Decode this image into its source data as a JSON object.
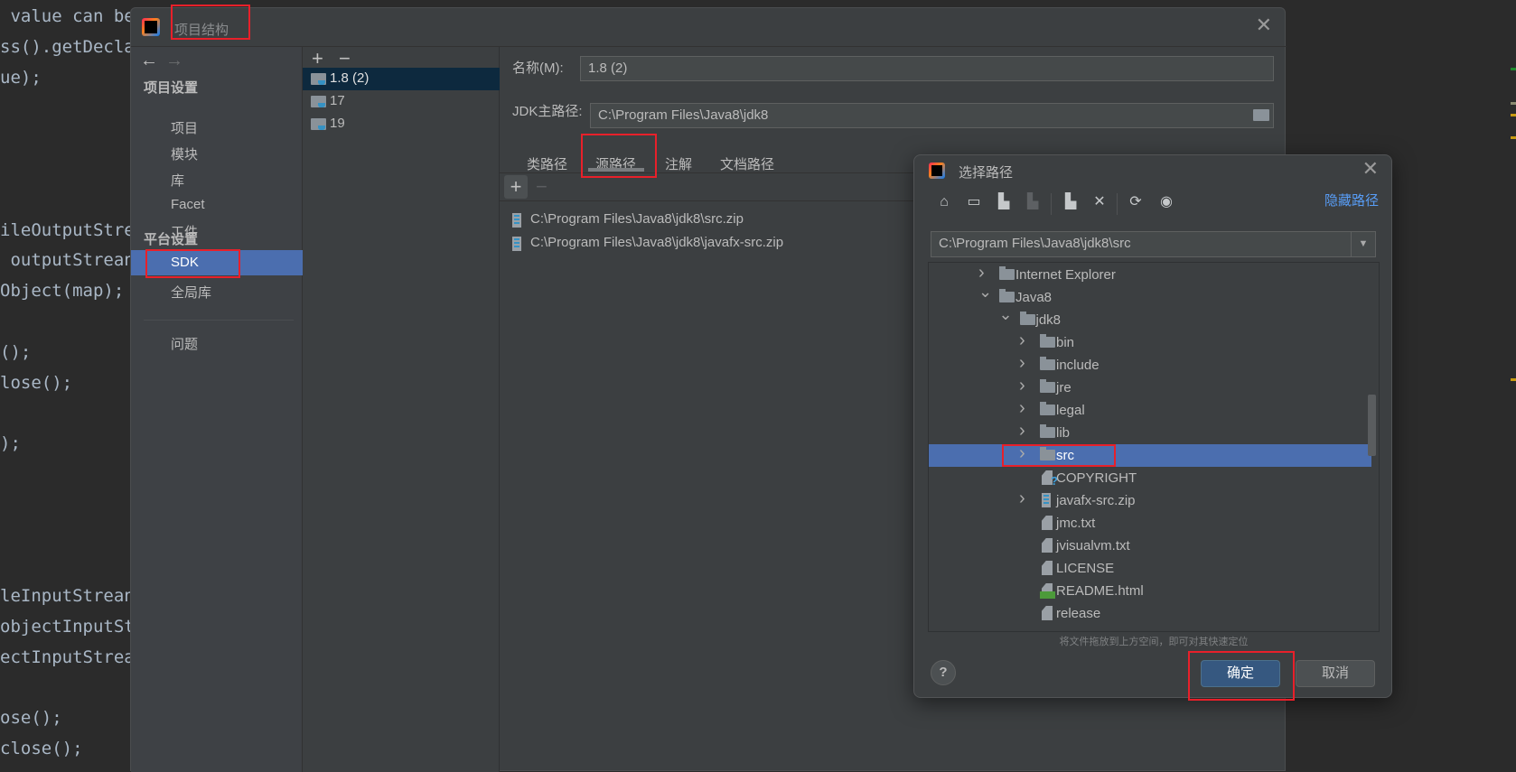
{
  "editor": {
    "code_lines": [
      {
        "line": 0,
        "text": " value can be"
      },
      {
        "line": 1,
        "text": "ss().getDecla"
      },
      {
        "line": 2,
        "text": "ue);"
      },
      {
        "line": 7,
        "text": "ileOutputStre"
      },
      {
        "line": 8,
        "text": " outputStrean"
      },
      {
        "line": 9,
        "text": "Object(map);"
      },
      {
        "line": 11,
        "text": "();"
      },
      {
        "line": 12,
        "text": "lose();"
      },
      {
        "line": 14,
        "text": ");"
      },
      {
        "line": 19,
        "text": "leInputStrean"
      },
      {
        "line": 20,
        "text": "objectInputSt"
      },
      {
        "line": 21,
        "text": "ectInputStrea"
      },
      {
        "line": 23,
        "text": "ose();"
      },
      {
        "line": 24,
        "text": "close();"
      }
    ],
    "gutter_marks": [
      "#1f8a2e",
      "#8a8a70",
      "#c79a12",
      "#c79a12",
      "#c79a12"
    ]
  },
  "main_dialog": {
    "title": "项目结构",
    "sidebar": {
      "project_settings_header": "项目设置",
      "project_items": [
        "项目",
        "模块",
        "库",
        "Facet",
        "工件"
      ],
      "platform_settings_header": "平台设置",
      "platform_items": [
        "SDK",
        "全局库"
      ],
      "selected": "SDK",
      "problems": "问题"
    },
    "sdk_list": {
      "items": [
        "1.8 (2)",
        "17",
        "19"
      ],
      "selected": "1.8 (2)"
    },
    "name_label": "名称(M):",
    "name_value": "1.8 (2)",
    "jdk_home_label": "JDK主路径:",
    "jdk_home_value": "C:\\Program Files\\Java8\\jdk8",
    "tabs": [
      "类路径",
      "源路径",
      "注解",
      "文档路径"
    ],
    "active_tab": "源路径",
    "source_paths": [
      "C:\\Program Files\\Java8\\jdk8\\src.zip",
      "C:\\Program Files\\Java8\\jdk8\\javafx-src.zip"
    ]
  },
  "chooser": {
    "title": "选择路径",
    "hide_path": "隐藏路径",
    "path_value": "C:\\Program Files\\Java8\\jdk8\\src",
    "tree": [
      {
        "label": "Internet Explorer",
        "level": 1,
        "type": "folder",
        "expand": "collapsed"
      },
      {
        "label": "Java8",
        "level": 1,
        "type": "folder",
        "expand": "expanded"
      },
      {
        "label": "jdk8",
        "level": 2,
        "type": "folder",
        "expand": "expanded"
      },
      {
        "label": "bin",
        "level": 3,
        "type": "folder",
        "expand": "collapsed"
      },
      {
        "label": "include",
        "level": 3,
        "type": "folder",
        "expand": "collapsed"
      },
      {
        "label": "jre",
        "level": 3,
        "type": "folder",
        "expand": "collapsed"
      },
      {
        "label": "legal",
        "level": 3,
        "type": "folder",
        "expand": "collapsed"
      },
      {
        "label": "lib",
        "level": 3,
        "type": "folder",
        "expand": "collapsed"
      },
      {
        "label": "src",
        "level": 3,
        "type": "folder",
        "expand": "collapsed",
        "selected": true
      },
      {
        "label": "COPYRIGHT",
        "level": 3,
        "type": "unknown"
      },
      {
        "label": "javafx-src.zip",
        "level": 3,
        "type": "zip",
        "expand": "collapsed"
      },
      {
        "label": "jmc.txt",
        "level": 3,
        "type": "text"
      },
      {
        "label": "jvisualvm.txt",
        "level": 3,
        "type": "text"
      },
      {
        "label": "LICENSE",
        "level": 3,
        "type": "text"
      },
      {
        "label": "README.html",
        "level": 3,
        "type": "html"
      },
      {
        "label": "release",
        "level": 3,
        "type": "text"
      }
    ],
    "hint": "将文件拖放到上方空间，即可对其快速定位",
    "ok": "确定",
    "cancel": "取消",
    "help": "?"
  },
  "colors": {
    "accent": "#4b6eaf",
    "link": "#589df6",
    "highlight_box": "#e8202a",
    "ok_button": "#365880"
  }
}
